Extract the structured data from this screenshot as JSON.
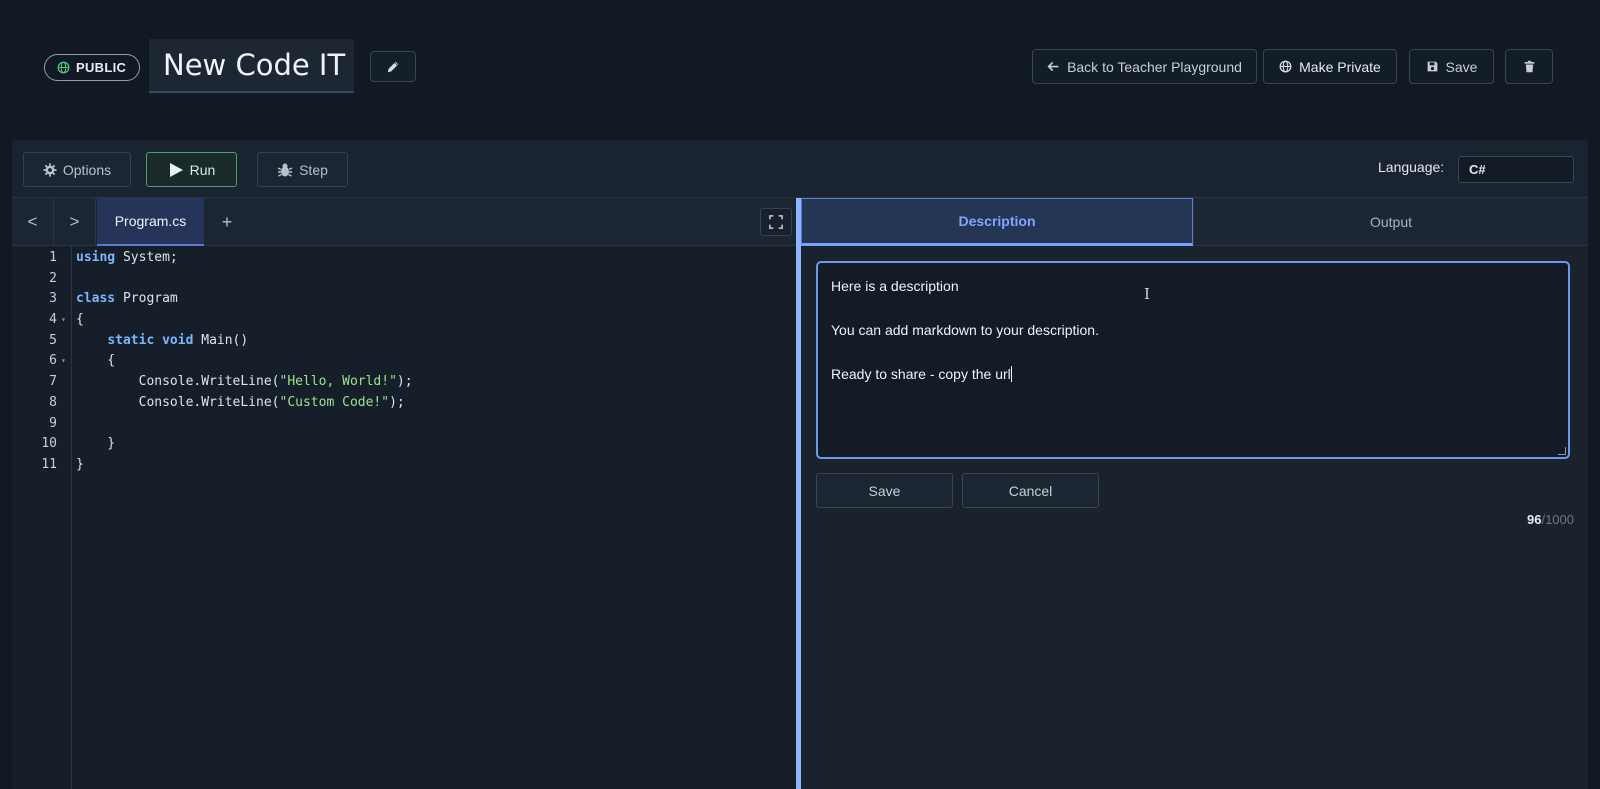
{
  "header": {
    "visibility_badge": "PUBLIC",
    "title": "New Code IT",
    "back_label": "Back to Teacher Playground",
    "make_private_label": "Make Private",
    "save_label": "Save"
  },
  "toolbar": {
    "options_label": "Options",
    "run_label": "Run",
    "step_label": "Step",
    "language_label": "Language:",
    "language_value": "C#"
  },
  "editor": {
    "prev_label": "<",
    "next_label": ">",
    "file_tab": "Program.cs",
    "add_tab": "+",
    "lines": [
      {
        "n": "1",
        "fold": "",
        "html": "<span class=\"kw\">using</span> System;"
      },
      {
        "n": "2",
        "fold": "",
        "html": ""
      },
      {
        "n": "3",
        "fold": "",
        "html": "<span class=\"kw\">class</span> Program"
      },
      {
        "n": "4",
        "fold": "▾",
        "html": "{"
      },
      {
        "n": "5",
        "fold": "",
        "html": "    <span class=\"kw\">static</span> <span class=\"kw\">void</span> Main()"
      },
      {
        "n": "6",
        "fold": "▾",
        "html": "    {"
      },
      {
        "n": "7",
        "fold": "",
        "html": "        Console.WriteLine(<span class=\"str\">\"Hello, World!\"</span>);"
      },
      {
        "n": "8",
        "fold": "",
        "html": "        Console.WriteLine(<span class=\"str\">\"Custom Code!\"</span>);"
      },
      {
        "n": "9",
        "fold": "",
        "html": ""
      },
      {
        "n": "10",
        "fold": "",
        "html": "    }"
      },
      {
        "n": "11",
        "fold": "",
        "html": "}"
      }
    ]
  },
  "panel": {
    "tabs": [
      {
        "label": "Description",
        "active": true
      },
      {
        "label": "Output",
        "active": false
      }
    ],
    "description": {
      "line1": "Here is a description",
      "line2": "You can add markdown to your description.",
      "line3": "Ready to share - copy the url"
    },
    "save_label": "Save",
    "cancel_label": "Cancel",
    "char_count": "96",
    "char_max": "/1000"
  }
}
